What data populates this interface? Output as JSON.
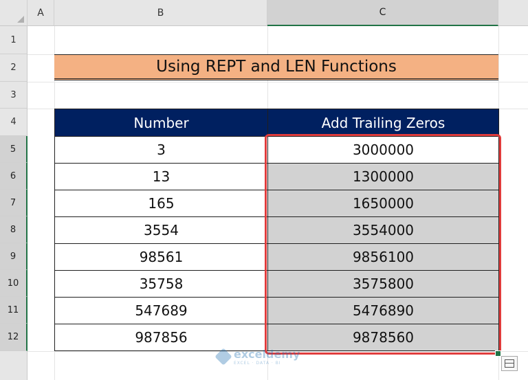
{
  "columns": [
    "A",
    "B",
    "C"
  ],
  "rows": [
    "1",
    "2",
    "3",
    "4",
    "5",
    "6",
    "7",
    "8",
    "9",
    "10",
    "11",
    "12"
  ],
  "title": "Using REPT and LEN Functions",
  "table": {
    "headers": [
      "Number",
      "Add Trailing Zeros"
    ],
    "rows": [
      [
        "3",
        "3000000"
      ],
      [
        "13",
        "1300000"
      ],
      [
        "165",
        "1650000"
      ],
      [
        "3554",
        "3554000"
      ],
      [
        "98561",
        "9856100"
      ],
      [
        "35758",
        "3575800"
      ],
      [
        "547689",
        "5476890"
      ],
      [
        "987856",
        "9878560"
      ]
    ]
  },
  "watermark": {
    "brand": "exceldemy",
    "tagline": "EXCEL · DATA · BI"
  },
  "colors": {
    "title_fill": "#f4b183",
    "header_fill": "#002060",
    "selection_border": "#e03c3c",
    "excel_green": "#217346"
  },
  "icons": {
    "quick_analysis": "quick-analysis-icon"
  }
}
